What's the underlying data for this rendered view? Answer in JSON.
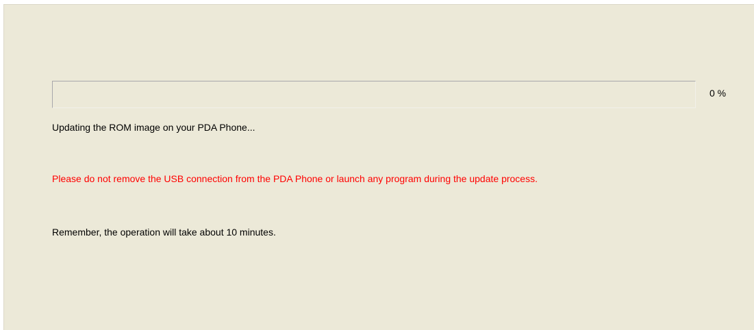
{
  "progress": {
    "value": 0,
    "label": "0 %"
  },
  "messages": {
    "status": "Updating the ROM image on your PDA Phone...",
    "warning": "Please do not remove the USB connection from the PDA Phone or launch any program during the update process.",
    "reminder": "Remember, the operation will take about 10 minutes."
  },
  "colors": {
    "panel_background": "#ece9d8",
    "warning_text": "#ff0000",
    "progress_fill": "#2f6fd6"
  }
}
